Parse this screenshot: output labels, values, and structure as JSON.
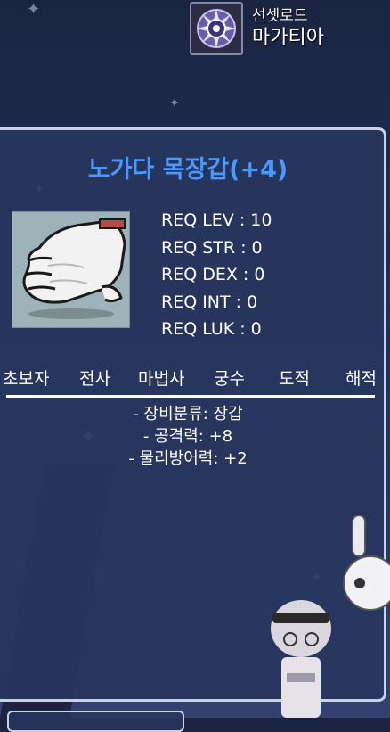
{
  "guild": {
    "guild_name": "선셋로드",
    "player_name": "마가티아",
    "emblem_icon": "guild-emblem-icon"
  },
  "item": {
    "title": "노가다 목장갑(+4)",
    "title_color": "#4a98ff",
    "icon": "white-work-glove-icon",
    "requirements": [
      "REQ LEV : 10",
      "REQ STR : 0",
      "REQ DEX : 0",
      "REQ INT : 0",
      "REQ LUK : 0"
    ],
    "jobs": [
      "초보자",
      "전사",
      "마법사",
      "궁수",
      "도적",
      "해적"
    ],
    "stats": [
      "- 장비분류: 장갑",
      "- 공격력: +8",
      "- 물리방어력: +2"
    ]
  }
}
